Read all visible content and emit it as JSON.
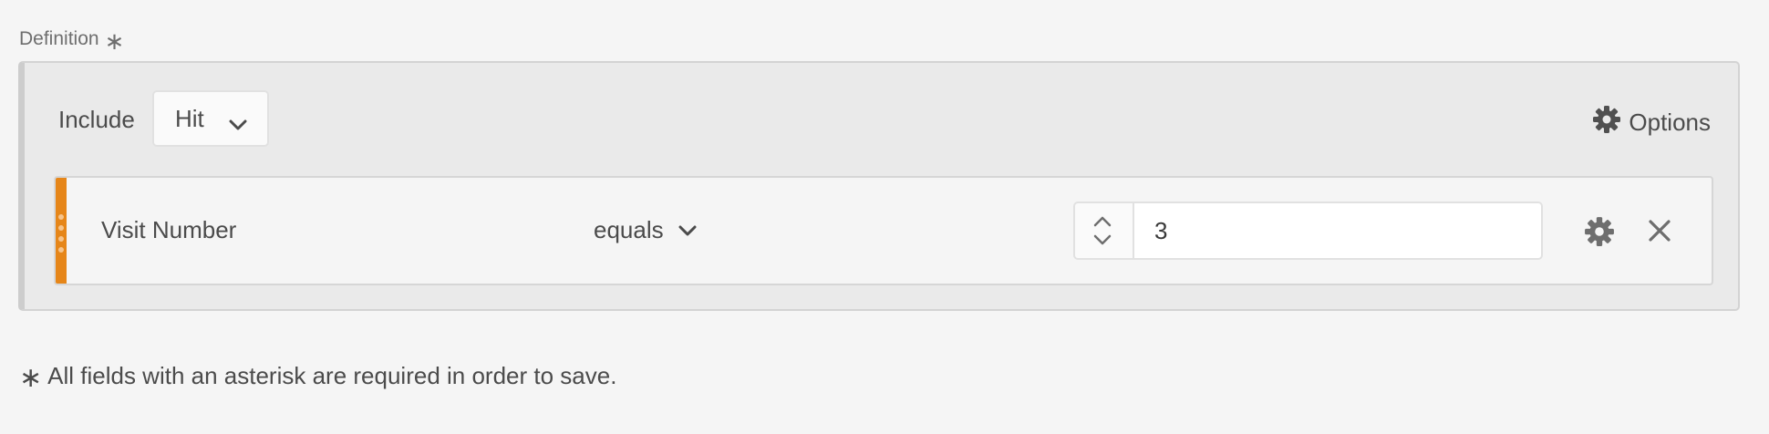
{
  "definition": {
    "label": "Definition",
    "required_marker": "∗"
  },
  "container": {
    "include_label": "Include",
    "scope_dropdown": {
      "selected": "Hit"
    },
    "options_label": "Options"
  },
  "rule": {
    "dimension": "Visit Number",
    "operator": "equals",
    "value": "3",
    "accent_color": "#e68619"
  },
  "footer": {
    "required_marker": "∗",
    "required_note": "All fields with an asterisk are required in order to save."
  },
  "icons": [
    "chevron-down-icon",
    "gear-icon",
    "drag-handle-icon",
    "stepper-icon",
    "close-icon"
  ]
}
